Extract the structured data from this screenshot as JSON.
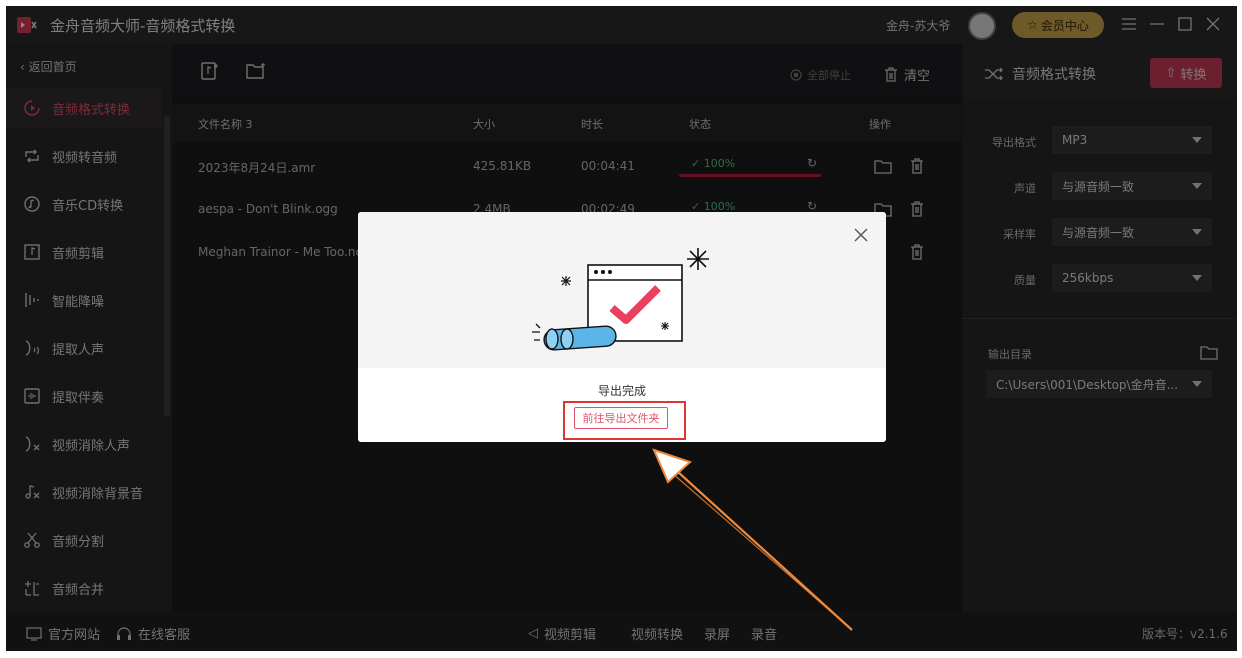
{
  "app": {
    "title": "金舟音频大师-音频格式转换",
    "user_name": "金舟-苏大爷",
    "vip_label": "会员中心"
  },
  "sidebar": {
    "back_label": "返回首页",
    "items": [
      {
        "label": "音频格式转换",
        "icon": "format-convert-icon"
      },
      {
        "label": "视频转音频",
        "icon": "video-to-audio-icon"
      },
      {
        "label": "音乐CD转换",
        "icon": "music-cd-icon"
      },
      {
        "label": "音频剪辑",
        "icon": "audio-clip-icon"
      },
      {
        "label": "智能降噪",
        "icon": "noise-reduction-icon"
      },
      {
        "label": "提取人声",
        "icon": "extract-vocal-icon"
      },
      {
        "label": "提取伴奏",
        "icon": "extract-accompaniment-icon"
      },
      {
        "label": "视频消除人声",
        "icon": "video-remove-vocal-icon"
      },
      {
        "label": "视频消除背景音",
        "icon": "video-remove-bg-icon"
      },
      {
        "label": "音频分割",
        "icon": "audio-split-icon"
      },
      {
        "label": "音频合并",
        "icon": "audio-merge-icon"
      }
    ]
  },
  "toolbar": {
    "stop_all_label": "全部停止",
    "clear_label": "清空"
  },
  "table": {
    "columns": [
      "文件名称 3",
      "大小",
      "时长",
      "状态",
      "操作"
    ],
    "rows": [
      {
        "name": "2023年8月24日.amr",
        "size": "425.81KB",
        "duration": "00:04:41",
        "status": "100%",
        "progress": 1.0
      },
      {
        "name": "aespa - Don't Blink.ogg",
        "size": "2.4MB",
        "duration": "00:02:49",
        "status": "100%",
        "progress": 1.0
      },
      {
        "name": "Meghan Trainor - Me Too.ncm",
        "size": "",
        "duration": "",
        "status": "",
        "progress": 0
      }
    ]
  },
  "panel": {
    "title": "音频格式转换",
    "convert_label": "转换",
    "options": [
      {
        "label": "导出格式",
        "value": "MP3"
      },
      {
        "label": "声道",
        "value": "与源音频一致"
      },
      {
        "label": "采样率",
        "value": "与源音频一致"
      },
      {
        "label": "质量",
        "value": "256kbps"
      }
    ],
    "output_label": "输出目录",
    "output_path": "C:\\Users\\001\\Desktop\\金舟音..."
  },
  "footer": {
    "website_label": "官方网站",
    "service_label": "在线客服",
    "links": [
      "视频剪辑",
      "视频转换",
      "录屏",
      "录音"
    ],
    "version": "版本号：v2.1.6"
  },
  "modal": {
    "message": "导出完成",
    "button_label": "前往导出文件夹"
  },
  "colors": {
    "accent": "#e2536d",
    "success": "#4fc08d",
    "highlight": "#e0342f",
    "annotation_arrow": "#f08a3c"
  }
}
